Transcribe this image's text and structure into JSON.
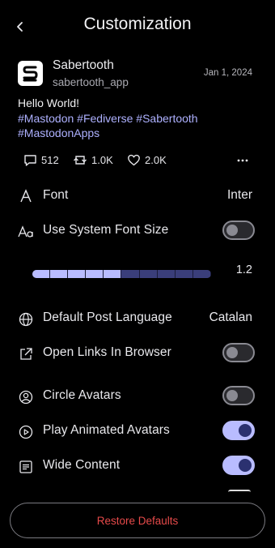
{
  "header": {
    "title": "Customization",
    "back_icon": "chevron-left-icon"
  },
  "post": {
    "display_name": "Sabertooth",
    "handle": "sabertooth_app",
    "date": "Jan 1, 2024",
    "text_line1": "Hello World!",
    "hashtags_line2": "#Mastodon #Fediverse #Sabertooth",
    "hashtags_line3": "#MastodonApps",
    "stats": {
      "replies": "512",
      "boosts": "1.0K",
      "favourites": "2.0K"
    }
  },
  "settings": {
    "font": {
      "label": "Font",
      "value": "Inter"
    },
    "system_font_size": {
      "label": "Use System Font Size",
      "enabled": false
    },
    "font_scale": {
      "value": "1.2",
      "fraction": 0.5,
      "segments": 10
    },
    "default_language": {
      "label": "Default Post Language",
      "value": "Catalan"
    },
    "open_links": {
      "label": "Open Links In Browser",
      "enabled": false
    },
    "circle_avatars": {
      "label": "Circle Avatars",
      "enabled": false
    },
    "animated_avatars": {
      "label": "Play Animated Avatars",
      "enabled": true
    },
    "wide_content": {
      "label": "Wide Content",
      "enabled": true
    }
  },
  "footer": {
    "restore_label": "Restore Defaults"
  },
  "colors": {
    "accent": "#b9bcff",
    "hashtag": "#aeb1ff",
    "danger": "#e64a4a",
    "background": "#000000"
  }
}
